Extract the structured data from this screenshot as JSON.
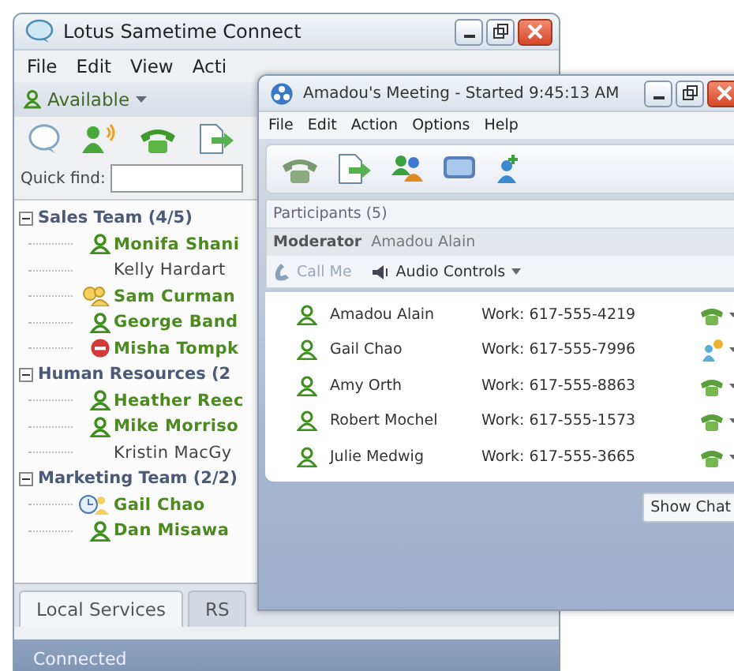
{
  "main_window": {
    "title": "Lotus Sametime Connect",
    "menu": [
      "File",
      "Edit",
      "View",
      "Acti"
    ],
    "status": {
      "label": "Available"
    },
    "quick_find": {
      "label": "Quick find:"
    },
    "groups": [
      {
        "name": "Sales Team (4/5)",
        "expanded": true,
        "contacts": [
          {
            "name": "Monifa Shani",
            "kind": "available"
          },
          {
            "name": "Kelly Hardart",
            "kind": "offline"
          },
          {
            "name": "Sam Curman",
            "kind": "away"
          },
          {
            "name": "George Band",
            "kind": "available"
          },
          {
            "name": "Misha Tompk",
            "kind": "dnd"
          }
        ]
      },
      {
        "name": "Human Resources (2",
        "expanded": true,
        "contacts": [
          {
            "name": "Heather Reec",
            "kind": "available"
          },
          {
            "name": "Mike Morriso",
            "kind": "available"
          },
          {
            "name": "Kristin MacGy",
            "kind": "offline"
          }
        ]
      },
      {
        "name": "Marketing Team (2/2)",
        "expanded": true,
        "contacts": [
          {
            "name": "Gail Chao",
            "kind": "meeting"
          },
          {
            "name": "Dan Misawa",
            "kind": "available"
          }
        ]
      }
    ],
    "tabs": [
      {
        "label": "Local Services",
        "selected": true
      },
      {
        "label": "RS",
        "selected": false
      }
    ],
    "status_bar": "Connected"
  },
  "meeting_window": {
    "title": "Amadou's Meeting - Started 9:45:13 AM",
    "menu": [
      "File",
      "Edit",
      "Action",
      "Options",
      "Help"
    ],
    "participants_header": "Participants (5)",
    "moderator_label": "Moderator",
    "moderator": "Amadou Alain",
    "call_me": {
      "label": "Call Me",
      "disabled": true
    },
    "audio_controls": "Audio Controls",
    "participants": [
      {
        "name": "Amadou Alain",
        "phone": "Work: 617-555-4219",
        "kind": "phone"
      },
      {
        "name": "Gail Chao",
        "phone": "Work: 617-555-7996",
        "kind": "computer"
      },
      {
        "name": "Amy Orth",
        "phone": "Work: 617-555-8863",
        "kind": "phone"
      },
      {
        "name": "Robert Mochel",
        "phone": "Work: 617-555-1573",
        "kind": "phone"
      },
      {
        "name": "Julie Medwig",
        "phone": "Work: 617-555-3665",
        "kind": "phone"
      }
    ],
    "show_chat": "Show Chat"
  }
}
